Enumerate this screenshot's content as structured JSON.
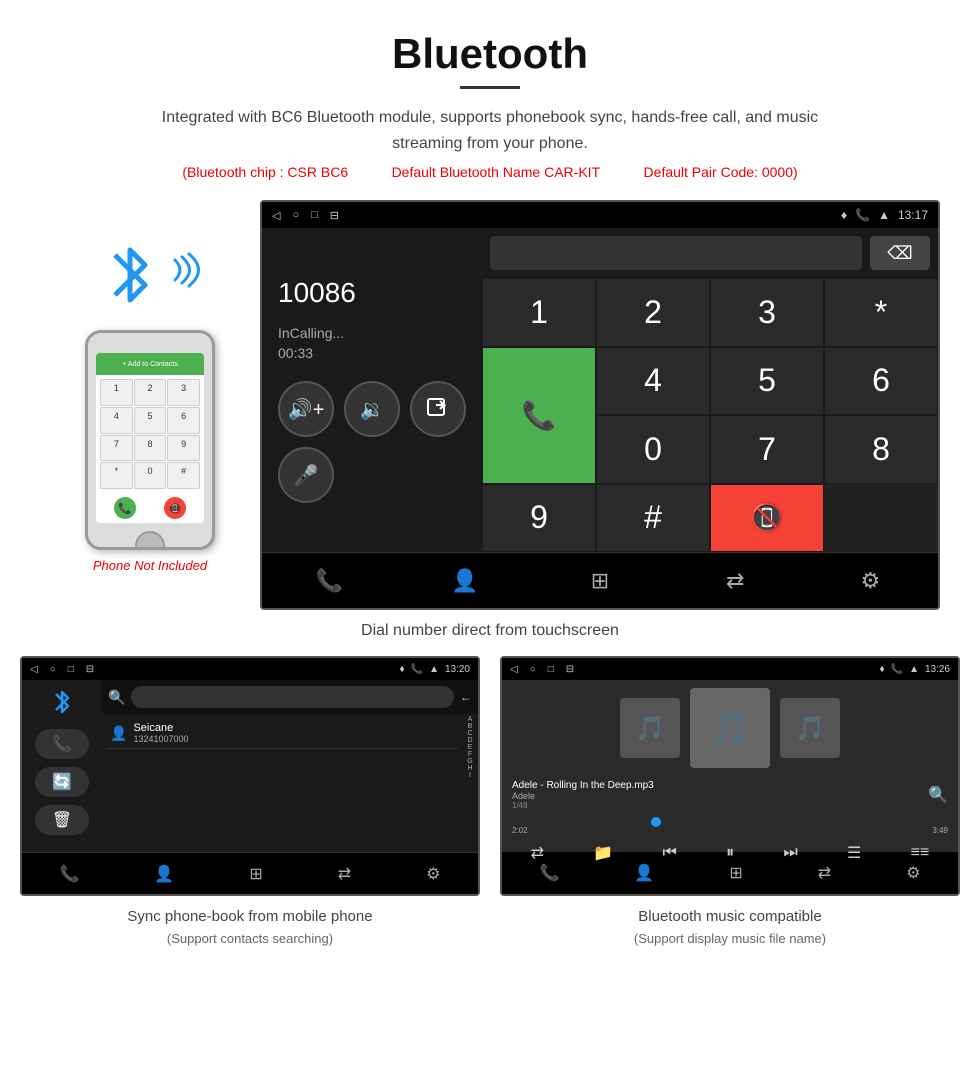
{
  "page": {
    "title": "Bluetooth",
    "description": "Integrated with BC6 Bluetooth module, supports phonebook sync, hands-free call, and music streaming from your phone.",
    "specs": {
      "chip": "(Bluetooth chip : CSR BC6",
      "name": "Default Bluetooth Name CAR-KIT",
      "code": "Default Pair Code: 0000)"
    }
  },
  "main_screen": {
    "status_bar": {
      "time": "13:17",
      "icons": [
        "◁",
        "○",
        "□",
        "⊟"
      ]
    },
    "call": {
      "number": "10086",
      "status": "InCalling...",
      "timer": "00:33"
    },
    "dialpad": {
      "keys": [
        "1",
        "2",
        "3",
        "*",
        "4",
        "5",
        "6",
        "0",
        "7",
        "8",
        "9",
        "#"
      ]
    },
    "caption": "Dial number direct from touchscreen"
  },
  "phonebook_screen": {
    "status_bar": {
      "time": "13:20"
    },
    "contact": {
      "name": "Seicane",
      "number": "13241007000"
    },
    "alphabet": [
      "A",
      "B",
      "C",
      "D",
      "E",
      "F",
      "G",
      "H",
      "I"
    ],
    "caption_main": "Sync phone-book from mobile phone",
    "caption_sub": "(Support contacts searching)"
  },
  "music_screen": {
    "status_bar": {
      "time": "13:26"
    },
    "track": {
      "title": "Adele - Rolling In the Deep.mp3",
      "artist": "Adele",
      "count": "1/48"
    },
    "time": {
      "current": "2:02",
      "total": "3:49"
    },
    "caption_main": "Bluetooth music compatible",
    "caption_sub": "(Support display music file name)"
  },
  "phone_side": {
    "not_included": "Phone Not Included"
  },
  "icons": {
    "bluetooth": "✱",
    "volume_up": "🔊",
    "volume_down": "🔉",
    "transfer": "↗",
    "mic": "🎤",
    "call": "📞",
    "end_call": "📵",
    "backspace": "⌫",
    "contacts": "👤",
    "dialpad_icon": "⊞",
    "transfer_icon": "⇄",
    "settings": "⚙",
    "shuffle": "⇄",
    "prev": "⏮",
    "play_pause": "⏸",
    "next": "⏭",
    "equalizer": "≡",
    "folder": "📁",
    "list": "☰"
  }
}
